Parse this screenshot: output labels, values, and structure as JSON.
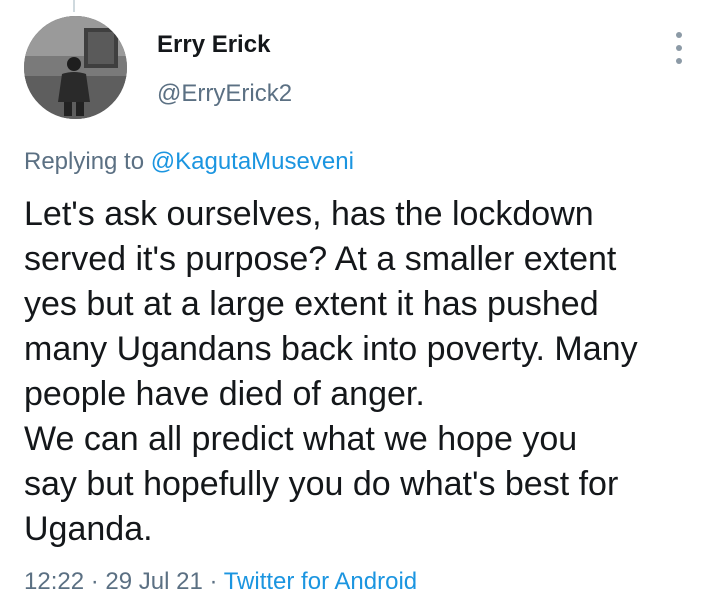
{
  "author": {
    "display_name": "Erry Erick",
    "handle": "@ErryErick2"
  },
  "reply": {
    "prefix": "Replying to ",
    "to_handle": "@KagutaMuseveni"
  },
  "tweet": {
    "text": "Let's ask ourselves, has the lockdown\nserved it's purpose? At a smaller extent\nyes but at a large extent it has pushed\nmany Ugandans back into poverty. Many\npeople have died of anger.\nWe can all predict what we hope you\nsay but hopefully you do what's best for\nUganda."
  },
  "meta": {
    "time": "12:22",
    "sep1": " · ",
    "date": "29 Jul 21",
    "sep2": " · ",
    "source": "Twitter for Android"
  },
  "icons": {
    "more": "more-vertical-icon"
  },
  "colors": {
    "link": "#1b95e0",
    "secondary_text": "#5b7083",
    "primary_text": "#14171a"
  }
}
